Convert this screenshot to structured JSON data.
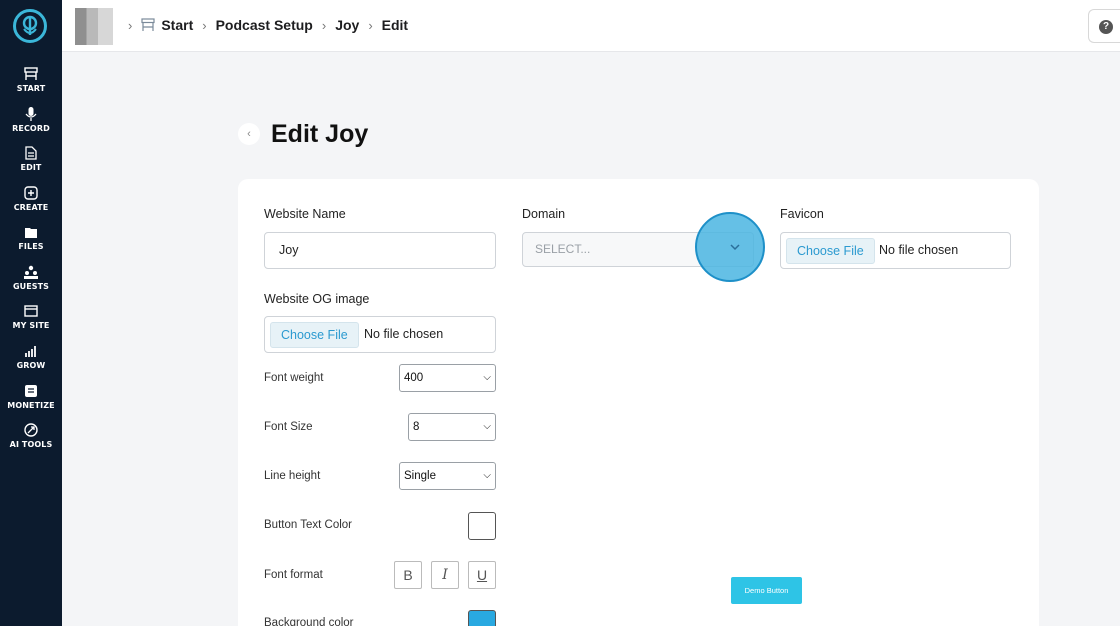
{
  "sidebar": {
    "items": [
      {
        "label": "START",
        "icon": "start-icon"
      },
      {
        "label": "RECORD",
        "icon": "microphone-icon"
      },
      {
        "label": "EDIT",
        "icon": "edit-icon"
      },
      {
        "label": "CREATE",
        "icon": "create-icon"
      },
      {
        "label": "FILES",
        "icon": "files-icon"
      },
      {
        "label": "GUESTS",
        "icon": "guests-icon"
      },
      {
        "label": "MY SITE",
        "icon": "my-site-icon"
      },
      {
        "label": "GROW",
        "icon": "grow-icon"
      },
      {
        "label": "MONETIZE",
        "icon": "monetize-icon"
      },
      {
        "label": "AI TOOLS",
        "icon": "ai-tools-icon"
      }
    ],
    "colors": {
      "background": "#0c1b2e",
      "accent": "#3bb7d9"
    }
  },
  "breadcrumb": {
    "items": [
      "Start",
      "Podcast Setup",
      "Joy",
      "Edit"
    ]
  },
  "help": {
    "label": "?"
  },
  "page": {
    "title": "Edit Joy"
  },
  "form": {
    "website_name": {
      "label": "Website Name",
      "value": "Joy"
    },
    "domain": {
      "label": "Domain",
      "placeholder": "SELECT..."
    },
    "favicon": {
      "label": "Favicon",
      "button": "Choose File",
      "status": "No file chosen"
    },
    "og_image": {
      "label": "Website OG image",
      "button": "Choose File",
      "status": "No file chosen"
    },
    "font_weight": {
      "label": "Font weight",
      "value": "400"
    },
    "font_size": {
      "label": "Font Size",
      "value": "8"
    },
    "line_height": {
      "label": "Line height",
      "value": "Single"
    },
    "button_text_color": {
      "label": "Button Text Color",
      "color": "#ffffff"
    },
    "font_format": {
      "label": "Font format",
      "bold": "B",
      "italic": "I",
      "underline": "U"
    },
    "background_color": {
      "label": "Background color",
      "color": "#29a9e1"
    },
    "demo_button": {
      "label": "Demo Button",
      "color": "#2ec4e6"
    }
  }
}
